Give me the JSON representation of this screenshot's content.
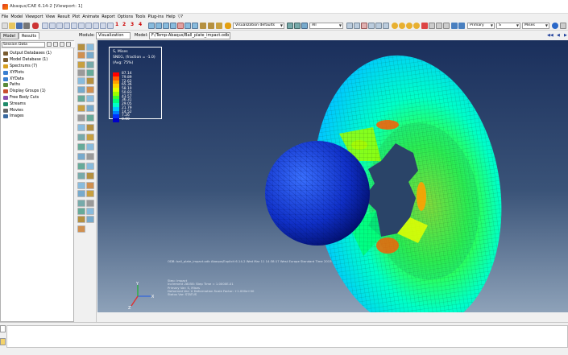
{
  "window": {
    "title": "Abaqus/CAE 6.14-2 [Viewport: 1]"
  },
  "menu": [
    "File",
    "Model",
    "Viewport",
    "View",
    "Result",
    "Plot",
    "Animate",
    "Report",
    "Options",
    "Tools",
    "Plug-ins",
    "Help",
    "▽?"
  ],
  "toolbar": {
    "step_numbers": [
      "1",
      "2",
      "3",
      "4"
    ],
    "visualization_defaults": "Visualization defaults",
    "all_select": "All",
    "primary_select": "Primary",
    "field_select": "S",
    "invariant_select": "Mises"
  },
  "tabs": [
    "Model",
    "Results"
  ],
  "module_row": {
    "module_label": "Module:",
    "module_value": "Visualization",
    "model_label": "Model:",
    "model_value": "F:/Temp-Abaqus/Ball_plate_impact.odb"
  },
  "tree": {
    "session_data": "Session Data",
    "items": [
      {
        "label": "Output Databases (1)",
        "icon": "database-icon",
        "color": "#7a5c2e"
      },
      {
        "label": "Model Database (1)",
        "icon": "database-icon",
        "color": "#7a5c2e"
      },
      {
        "label": "Spectrums (7)",
        "icon": "spectrum-icon",
        "color": "#d8a020"
      },
      {
        "label": "XYPlots",
        "icon": "xyplot-icon",
        "color": "#3a7fd0"
      },
      {
        "label": "XYData",
        "icon": "xydata-icon",
        "color": "#3a7fd0"
      },
      {
        "label": "Paths",
        "icon": "path-icon",
        "color": "#5a8a3a"
      },
      {
        "label": "Display Groups (1)",
        "icon": "display-group-icon",
        "color": "#c84f30"
      },
      {
        "label": "Free Body Cuts",
        "icon": "free-body-icon",
        "color": "#8a4fb0"
      },
      {
        "label": "Streams",
        "icon": "stream-icon",
        "color": "#1f8a6a"
      },
      {
        "label": "Movies",
        "icon": "movie-icon",
        "color": "#666666"
      },
      {
        "label": "Images",
        "icon": "image-icon",
        "color": "#3a6aa0"
      }
    ]
  },
  "legend": {
    "title": "S, Mises",
    "subtitle": "SNEG, (fraction = -1.0)",
    "avg": "(Avg: 75%)",
    "values": [
      "+8.714e+01",
      "+7.989e+01",
      "+7.263e+01",
      "+6.536e+01",
      "+5.810e+01",
      "+5.083e+01",
      "+4.357e+01",
      "+3.631e+01",
      "+2.904e+01",
      "+2.178e+01",
      "+1.452e+01",
      "+7.26e+00",
      "+0.00e+00"
    ],
    "display_values": [
      "87.14",
      "79.89",
      "72.62",
      "65.36",
      "58.10",
      "50.83",
      "43.57",
      "36.31",
      "29.05",
      "21.79",
      "14.52",
      "7.26",
      "0.00"
    ],
    "colors": [
      "#ff0000",
      "#ff5a00",
      "#ffa000",
      "#ffd400",
      "#e4ff00",
      "#9cff00",
      "#3cff30",
      "#00ff7a",
      "#00ffc8",
      "#00c8ff",
      "#0080ff",
      "#0030ff",
      "#0000c8"
    ]
  },
  "viewport_info": {
    "odb_line": "ODB: ball_plate_impact.odb    Abaqus/Explicit 6.14-2    Wed Mar 11 14:38:17 West Europe Standard Time 2015",
    "step_lines": [
      "Step: Impact",
      "Increment    28058: Step Time =    1.0000E-01",
      "Primary Var: S, Mises",
      "Deformed Var: U   Deformation Scale Factor: +1.000e+00",
      "Status Var: STATUS"
    ]
  },
  "triad": {
    "x": "X",
    "y": "Y",
    "z": "Z"
  }
}
